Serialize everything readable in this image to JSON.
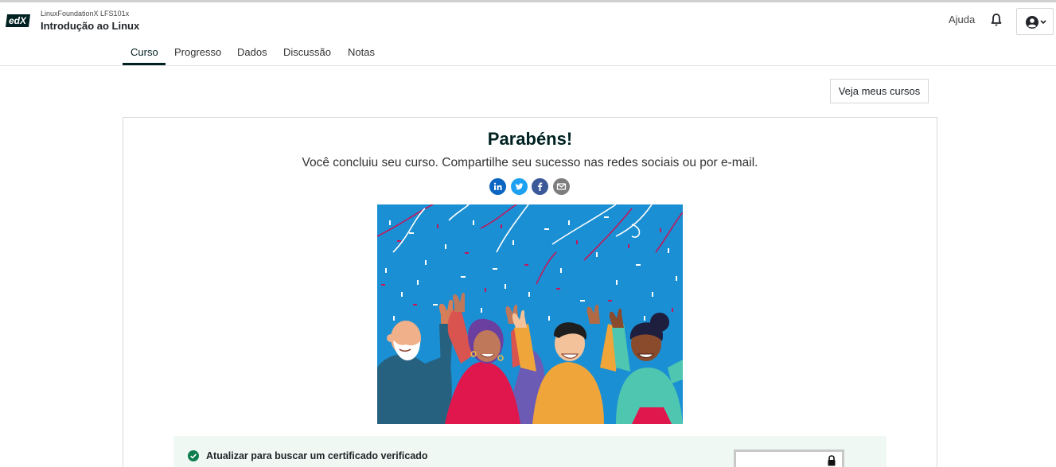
{
  "header": {
    "logo_text": "edX",
    "course_org": "LinuxFoundationX LFS101x",
    "course_title": "Introdução ao Linux",
    "help_label": "Ajuda",
    "icons": [
      "bell-icon",
      "user-avatar-icon",
      "chevron-down-icon"
    ]
  },
  "nav": {
    "tabs": [
      {
        "label": "Curso",
        "active": true
      },
      {
        "label": "Progresso",
        "active": false
      },
      {
        "label": "Dados",
        "active": false
      },
      {
        "label": "Discussão",
        "active": false
      },
      {
        "label": "Notas",
        "active": false
      }
    ]
  },
  "actions": {
    "my_courses_label": "Veja meus cursos"
  },
  "celebration": {
    "title": "Parabéns!",
    "subtitle": "Você concluiu seu curso. Compartilhe seu sucesso nas redes sociais ou por e-mail.",
    "share_icons": [
      {
        "name": "linkedin-icon",
        "color": "#0a66c2"
      },
      {
        "name": "twitter-icon",
        "color": "#1da1f2"
      },
      {
        "name": "facebook-icon",
        "color": "#3b5998"
      },
      {
        "name": "email-icon",
        "color": "#7d7d7d"
      }
    ]
  },
  "certificate": {
    "upgrade_text": "Atualizar para buscar um certificado verificado",
    "accent_color": "#0d7d4d"
  },
  "colors": {
    "brand_dark": "#002121",
    "illustration_bg": "#1b8fd3"
  }
}
